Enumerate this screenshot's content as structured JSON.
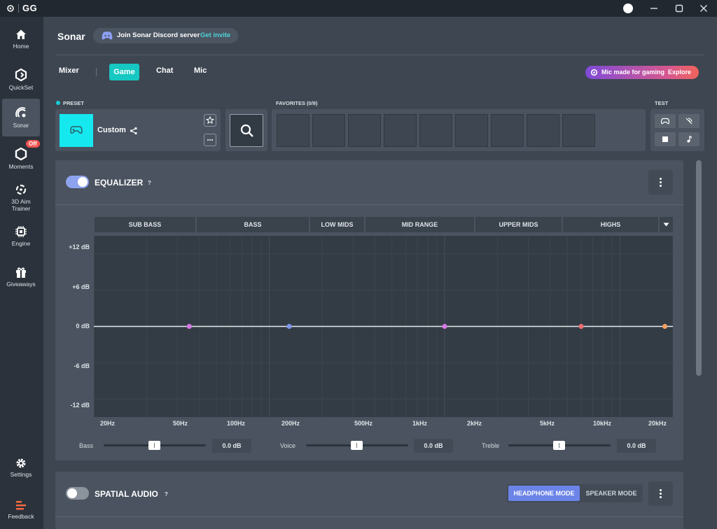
{
  "app": {
    "title": "GG"
  },
  "sidebar": {
    "items": [
      {
        "label": "Home",
        "icon": "home-icon"
      },
      {
        "label": "QuickSet",
        "icon": "quickset-icon"
      },
      {
        "label": "Sonar",
        "icon": "sonar-icon"
      },
      {
        "label": "Moments",
        "icon": "moments-icon",
        "badge": "Off"
      },
      {
        "label": "3D Aim Trainer",
        "icon": "aim-trainer-icon"
      },
      {
        "label": "Engine",
        "icon": "engine-chip-icon"
      },
      {
        "label": "Giveaways",
        "icon": "gift-icon"
      },
      {
        "label": "Settings",
        "icon": "gear-icon"
      },
      {
        "label": "Feedback",
        "icon": "feedback-icon"
      }
    ],
    "active": "Sonar"
  },
  "header": {
    "title": "Sonar",
    "discord": {
      "text": "Join Sonar Discord server",
      "link": "Get invite"
    }
  },
  "tabs": {
    "items": [
      "Mixer",
      "Game",
      "Chat",
      "Mic"
    ],
    "active": "Game"
  },
  "promo": {
    "text": "Mic made for gaming",
    "link": "Explore"
  },
  "preset": {
    "section_label": "PRESET",
    "name": "Custom"
  },
  "favorites": {
    "section_label": "FAVORITES (0/9)",
    "slots": 9
  },
  "test": {
    "section_label": "TEST"
  },
  "equalizer": {
    "title": "EQUALIZER",
    "help": "?",
    "enabled": true,
    "bands": [
      "SUB BASS",
      "BASS",
      "LOW MIDS",
      "MID RANGE",
      "UPPER MIDS",
      "HIGHS"
    ],
    "sliders": [
      {
        "label": "Bass",
        "value": "0.0 dB"
      },
      {
        "label": "Voice",
        "value": "0.0 dB"
      },
      {
        "label": "Treble",
        "value": "0.0 dB"
      }
    ]
  },
  "chart_data": {
    "type": "line",
    "title": "",
    "xscale": "log",
    "xlim": [
      10,
      20000
    ],
    "ylim": [
      -15,
      15
    ],
    "y_ticks": [
      "+12 dB",
      "+6 dB",
      "0 dB",
      "-6 dB",
      "-12 dB"
    ],
    "x_ticks": [
      "20Hz",
      "50Hz",
      "100Hz",
      "200Hz",
      "500Hz",
      "1kHz",
      "2kHz",
      "5kHz",
      "10kHz",
      "20kHz"
    ],
    "series": [
      {
        "points": [
          {
            "x": 35,
            "y": 0,
            "color": "#d877e6"
          },
          {
            "x": 130,
            "y": 0,
            "color": "#7d97e8"
          },
          {
            "x": 1000,
            "y": 0,
            "color": "#d877e6"
          },
          {
            "x": 6000,
            "y": 0,
            "color": "#ec6f6f"
          },
          {
            "x": 18000,
            "y": 0,
            "color": "#f0a060"
          }
        ]
      }
    ]
  },
  "spatial_audio": {
    "title": "SPATIAL AUDIO",
    "help": "?",
    "enabled": false,
    "modes": [
      "HEADPHONE MODE",
      "SPEAKER MODE"
    ],
    "active_mode": "HEADPHONE MODE"
  },
  "colors": {
    "accent": "#16c8c1",
    "toggle_on": "#8da3f0",
    "mode_active": "#6c84e8"
  }
}
